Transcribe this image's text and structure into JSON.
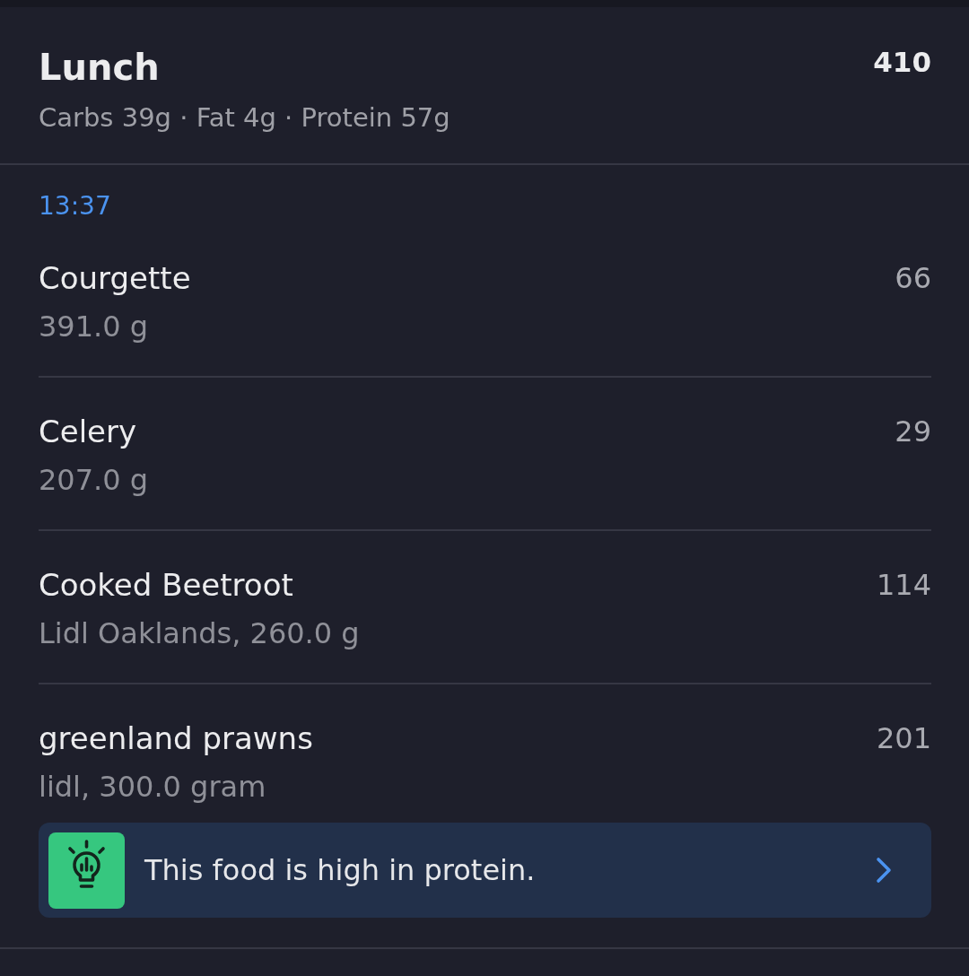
{
  "meal": {
    "title": "Lunch",
    "calories": "410",
    "macros": "Carbs 39g · Fat 4g · Protein 57g"
  },
  "entries": [
    {
      "time": "13:37",
      "items": [
        {
          "name": "Courgette",
          "detail": "391.0 g",
          "calories": "66"
        },
        {
          "name": "Celery",
          "detail": "207.0 g",
          "calories": "29"
        },
        {
          "name": "Cooked Beetroot",
          "detail": "Lidl Oaklands, 260.0 g",
          "calories": "114"
        },
        {
          "name": "greenland prawns",
          "detail": "lidl, 300.0 gram",
          "calories": "201",
          "tip": {
            "text": "This food is high in protein."
          }
        }
      ]
    }
  ]
}
